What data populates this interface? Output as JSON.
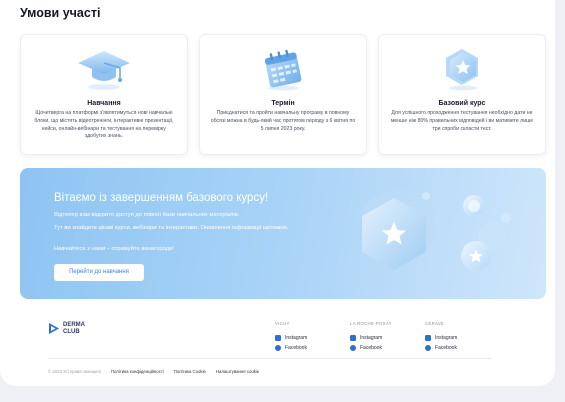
{
  "page": {
    "title": "Умови участі"
  },
  "cards": [
    {
      "icon": "graduation-cap-icon",
      "title": "Навчання",
      "description": "Щочетверга на платформі з'являтимуться нові навчальні блоки, що містять відеотренінги, інтерактивні презентації, кейси, онлайн-вебінари та тестування на перевірку здобутих знань."
    },
    {
      "icon": "calendar-icon",
      "title": "Термін",
      "description": "Приєднатися та пройти навчальну програму в повному обсязі можна в будь-який час протягом періоду з 6 квітня по 5 липня 2023 року."
    },
    {
      "icon": "star-badge-icon",
      "title": "Базовий курс",
      "description": "Для успішного проходження тестування необхідно дати не менше ніж 80% правильних відповідей і ви матимете лише три спроби скласти тест."
    }
  ],
  "banner": {
    "heading": "Вітаємо із завершенням базового курсу!",
    "paragraphs": [
      "Відтепер вам відкрито доступ до повної бази навчальних матеріалів.",
      "Тут ви знайдете цікаві курси, вебінари та інтерактиви. Оновлення інформації щотижня.",
      "Навчайтеся з нами – отримуйте винагороди!"
    ],
    "button_label": "Перейти до навчання"
  },
  "footer": {
    "logo_line1": "DERMA",
    "logo_line2": "CLUB",
    "columns": [
      {
        "heading": "VICHY",
        "links": [
          "Instagram",
          "Facebook"
        ]
      },
      {
        "heading": "LA ROCHE-POSAY",
        "links": [
          "Instagram",
          "Facebook"
        ]
      },
      {
        "heading": "CERAVE",
        "links": [
          "Instagram",
          "Facebook"
        ]
      }
    ],
    "copyright": "© 2023 Усі права захищені",
    "legal_links": [
      "Політика конфіденційності",
      "Політика Cookie",
      "Налаштування cookie"
    ]
  },
  "colors": {
    "accent": "#2f6fcf",
    "banner_start": "#8ec4f2",
    "banner_end": "#cfe6fb"
  }
}
